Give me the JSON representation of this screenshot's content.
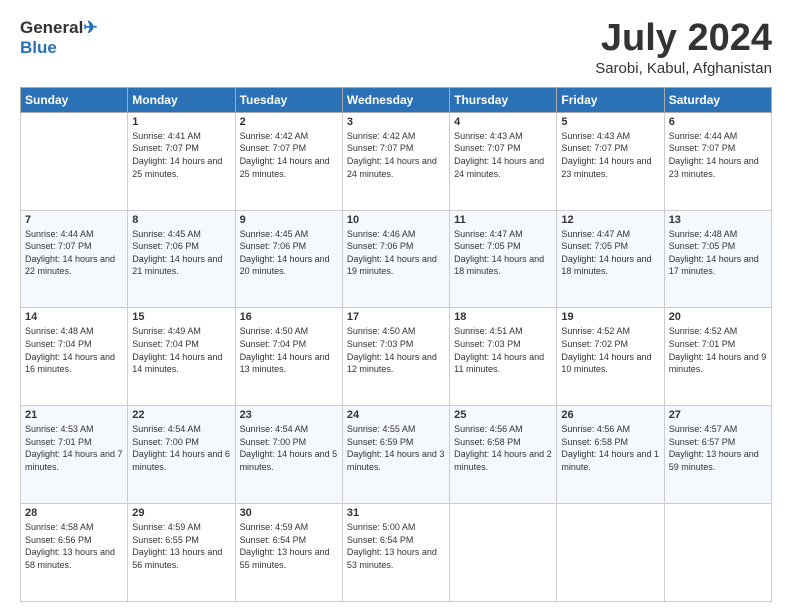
{
  "header": {
    "logo_line1": "General",
    "logo_line2": "Blue",
    "month": "July 2024",
    "location": "Sarobi, Kabul, Afghanistan"
  },
  "weekdays": [
    "Sunday",
    "Monday",
    "Tuesday",
    "Wednesday",
    "Thursday",
    "Friday",
    "Saturday"
  ],
  "weeks": [
    [
      {
        "day": "",
        "sunrise": "",
        "sunset": "",
        "daylight": ""
      },
      {
        "day": "1",
        "sunrise": "Sunrise: 4:41 AM",
        "sunset": "Sunset: 7:07 PM",
        "daylight": "Daylight: 14 hours and 25 minutes."
      },
      {
        "day": "2",
        "sunrise": "Sunrise: 4:42 AM",
        "sunset": "Sunset: 7:07 PM",
        "daylight": "Daylight: 14 hours and 25 minutes."
      },
      {
        "day": "3",
        "sunrise": "Sunrise: 4:42 AM",
        "sunset": "Sunset: 7:07 PM",
        "daylight": "Daylight: 14 hours and 24 minutes."
      },
      {
        "day": "4",
        "sunrise": "Sunrise: 4:43 AM",
        "sunset": "Sunset: 7:07 PM",
        "daylight": "Daylight: 14 hours and 24 minutes."
      },
      {
        "day": "5",
        "sunrise": "Sunrise: 4:43 AM",
        "sunset": "Sunset: 7:07 PM",
        "daylight": "Daylight: 14 hours and 23 minutes."
      },
      {
        "day": "6",
        "sunrise": "Sunrise: 4:44 AM",
        "sunset": "Sunset: 7:07 PM",
        "daylight": "Daylight: 14 hours and 23 minutes."
      }
    ],
    [
      {
        "day": "7",
        "sunrise": "Sunrise: 4:44 AM",
        "sunset": "Sunset: 7:07 PM",
        "daylight": "Daylight: 14 hours and 22 minutes."
      },
      {
        "day": "8",
        "sunrise": "Sunrise: 4:45 AM",
        "sunset": "Sunset: 7:06 PM",
        "daylight": "Daylight: 14 hours and 21 minutes."
      },
      {
        "day": "9",
        "sunrise": "Sunrise: 4:45 AM",
        "sunset": "Sunset: 7:06 PM",
        "daylight": "Daylight: 14 hours and 20 minutes."
      },
      {
        "day": "10",
        "sunrise": "Sunrise: 4:46 AM",
        "sunset": "Sunset: 7:06 PM",
        "daylight": "Daylight: 14 hours and 19 minutes."
      },
      {
        "day": "11",
        "sunrise": "Sunrise: 4:47 AM",
        "sunset": "Sunset: 7:05 PM",
        "daylight": "Daylight: 14 hours and 18 minutes."
      },
      {
        "day": "12",
        "sunrise": "Sunrise: 4:47 AM",
        "sunset": "Sunset: 7:05 PM",
        "daylight": "Daylight: 14 hours and 18 minutes."
      },
      {
        "day": "13",
        "sunrise": "Sunrise: 4:48 AM",
        "sunset": "Sunset: 7:05 PM",
        "daylight": "Daylight: 14 hours and 17 minutes."
      }
    ],
    [
      {
        "day": "14",
        "sunrise": "Sunrise: 4:48 AM",
        "sunset": "Sunset: 7:04 PM",
        "daylight": "Daylight: 14 hours and 16 minutes."
      },
      {
        "day": "15",
        "sunrise": "Sunrise: 4:49 AM",
        "sunset": "Sunset: 7:04 PM",
        "daylight": "Daylight: 14 hours and 14 minutes."
      },
      {
        "day": "16",
        "sunrise": "Sunrise: 4:50 AM",
        "sunset": "Sunset: 7:04 PM",
        "daylight": "Daylight: 14 hours and 13 minutes."
      },
      {
        "day": "17",
        "sunrise": "Sunrise: 4:50 AM",
        "sunset": "Sunset: 7:03 PM",
        "daylight": "Daylight: 14 hours and 12 minutes."
      },
      {
        "day": "18",
        "sunrise": "Sunrise: 4:51 AM",
        "sunset": "Sunset: 7:03 PM",
        "daylight": "Daylight: 14 hours and 11 minutes."
      },
      {
        "day": "19",
        "sunrise": "Sunrise: 4:52 AM",
        "sunset": "Sunset: 7:02 PM",
        "daylight": "Daylight: 14 hours and 10 minutes."
      },
      {
        "day": "20",
        "sunrise": "Sunrise: 4:52 AM",
        "sunset": "Sunset: 7:01 PM",
        "daylight": "Daylight: 14 hours and 9 minutes."
      }
    ],
    [
      {
        "day": "21",
        "sunrise": "Sunrise: 4:53 AM",
        "sunset": "Sunset: 7:01 PM",
        "daylight": "Daylight: 14 hours and 7 minutes."
      },
      {
        "day": "22",
        "sunrise": "Sunrise: 4:54 AM",
        "sunset": "Sunset: 7:00 PM",
        "daylight": "Daylight: 14 hours and 6 minutes."
      },
      {
        "day": "23",
        "sunrise": "Sunrise: 4:54 AM",
        "sunset": "Sunset: 7:00 PM",
        "daylight": "Daylight: 14 hours and 5 minutes."
      },
      {
        "day": "24",
        "sunrise": "Sunrise: 4:55 AM",
        "sunset": "Sunset: 6:59 PM",
        "daylight": "Daylight: 14 hours and 3 minutes."
      },
      {
        "day": "25",
        "sunrise": "Sunrise: 4:56 AM",
        "sunset": "Sunset: 6:58 PM",
        "daylight": "Daylight: 14 hours and 2 minutes."
      },
      {
        "day": "26",
        "sunrise": "Sunrise: 4:56 AM",
        "sunset": "Sunset: 6:58 PM",
        "daylight": "Daylight: 14 hours and 1 minute."
      },
      {
        "day": "27",
        "sunrise": "Sunrise: 4:57 AM",
        "sunset": "Sunset: 6:57 PM",
        "daylight": "Daylight: 13 hours and 59 minutes."
      }
    ],
    [
      {
        "day": "28",
        "sunrise": "Sunrise: 4:58 AM",
        "sunset": "Sunset: 6:56 PM",
        "daylight": "Daylight: 13 hours and 58 minutes."
      },
      {
        "day": "29",
        "sunrise": "Sunrise: 4:59 AM",
        "sunset": "Sunset: 6:55 PM",
        "daylight": "Daylight: 13 hours and 56 minutes."
      },
      {
        "day": "30",
        "sunrise": "Sunrise: 4:59 AM",
        "sunset": "Sunset: 6:54 PM",
        "daylight": "Daylight: 13 hours and 55 minutes."
      },
      {
        "day": "31",
        "sunrise": "Sunrise: 5:00 AM",
        "sunset": "Sunset: 6:54 PM",
        "daylight": "Daylight: 13 hours and 53 minutes."
      },
      {
        "day": "",
        "sunrise": "",
        "sunset": "",
        "daylight": ""
      },
      {
        "day": "",
        "sunrise": "",
        "sunset": "",
        "daylight": ""
      },
      {
        "day": "",
        "sunrise": "",
        "sunset": "",
        "daylight": ""
      }
    ]
  ]
}
